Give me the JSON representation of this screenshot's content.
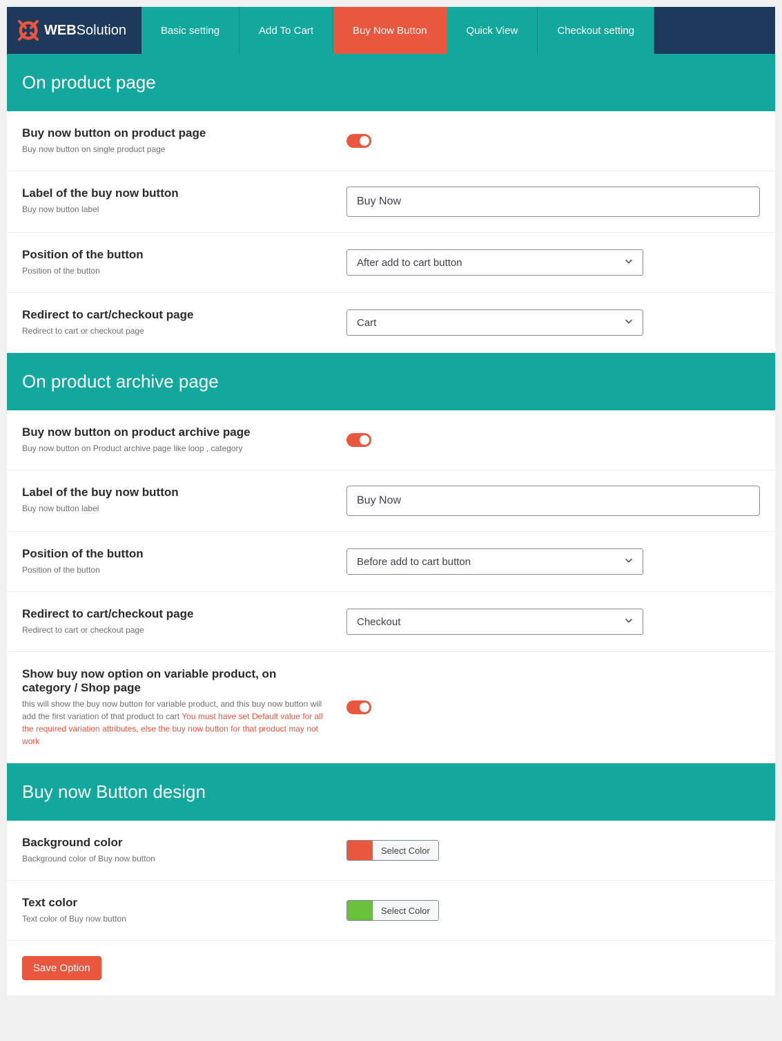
{
  "brand": {
    "bold": "WEB",
    "light": "Solution"
  },
  "tabs": {
    "basic": "Basic setting",
    "addcart": "Add To Cart",
    "buynow": "Buy Now Button",
    "quickview": "Quick View",
    "checkout": "Checkout setting"
  },
  "sections": {
    "productPage": {
      "header": "On product page",
      "enable": {
        "title": "Buy now button on product page",
        "desc": "Buy now button on single product page"
      },
      "label": {
        "title": "Label of the buy now button",
        "desc": "Buy now button label",
        "value": "Buy Now"
      },
      "position": {
        "title": "Position of the button",
        "desc": "Position of the button",
        "value": "After add to cart button"
      },
      "redirect": {
        "title": "Redirect to cart/checkout page",
        "desc": "Redirect to cart or checkout page",
        "value": "Cart"
      }
    },
    "archivePage": {
      "header": "On product archive page",
      "enable": {
        "title": "Buy now button on product archive page",
        "desc": "Buy now button on Product archive page like loop , category"
      },
      "label": {
        "title": "Label of the buy now button",
        "desc": "Buy now button label",
        "value": "Buy Now"
      },
      "position": {
        "title": "Position of the button",
        "desc": "Position of the button",
        "value": "Before add to cart button"
      },
      "redirect": {
        "title": "Redirect to cart/checkout page",
        "desc": "Redirect to cart or checkout page",
        "value": "Checkout"
      },
      "variable": {
        "title": "Show buy now option on variable product, on category / Shop page",
        "desc": "this will show the buy now button for variable product, and this buy now button will add the first variation of that product to cart ",
        "warn": "You must have set Default value for all the required variation attributes, else the buy now button for that product may not work"
      }
    },
    "design": {
      "header": "Buy now Button design",
      "bgcolor": {
        "title": "Background color",
        "desc": "Background color of Buy now button",
        "btn": "Select Color",
        "swatch": "#e9573f"
      },
      "textcolor": {
        "title": "Text color",
        "desc": "Text color of Buy now button",
        "btn": "Select Color",
        "swatch": "#6ac13b"
      }
    }
  },
  "save": "Save Option"
}
